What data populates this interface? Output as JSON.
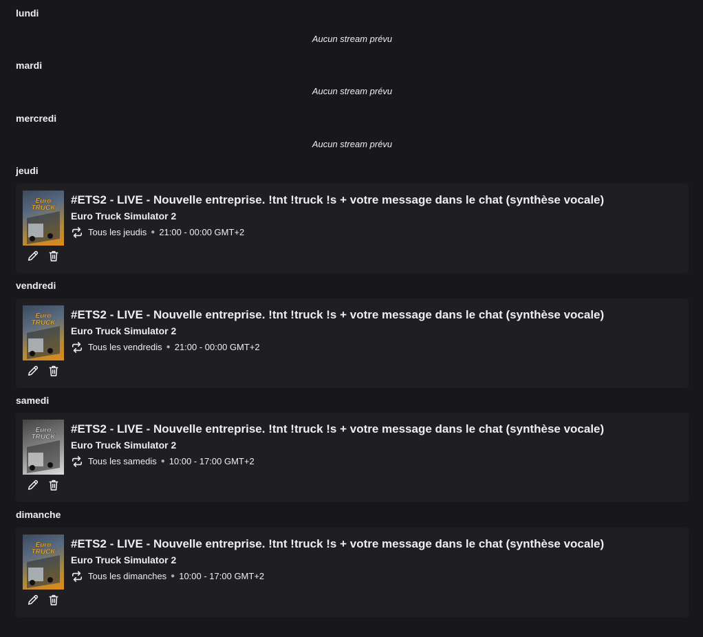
{
  "days": [
    {
      "label": "lundi",
      "empty_text": "Aucun stream prévu"
    },
    {
      "label": "mardi",
      "empty_text": "Aucun stream prévu"
    },
    {
      "label": "mercredi",
      "empty_text": "Aucun stream prévu"
    },
    {
      "label": "jeudi",
      "stream": {
        "title": "#ETS2 - LIVE - Nouvelle entreprise. !tnt !truck !s + votre message dans le chat (synthèse vocale)",
        "game": "Euro Truck Simulator 2",
        "recurrence": "Tous les jeudis",
        "time": "21:00 - 00:00 GMT+2",
        "thumbnail_icon": "euro-truck-simulator-2-cover"
      }
    },
    {
      "label": "vendredi",
      "stream": {
        "title": "#ETS2 - LIVE - Nouvelle entreprise. !tnt !truck !s + votre message dans le chat (synthèse vocale)",
        "game": "Euro Truck Simulator 2",
        "recurrence": "Tous les vendredis",
        "time": "21:00 - 00:00 GMT+2",
        "thumbnail_icon": "euro-truck-simulator-2-cover"
      }
    },
    {
      "label": "samedi",
      "stream": {
        "title": "#ETS2 - LIVE - Nouvelle entreprise. !tnt !truck !s + votre message dans le chat (synthèse vocale)",
        "game": "Euro Truck Simulator 2",
        "recurrence": "Tous les samedis",
        "time": "10:00 - 17:00 GMT+2",
        "thumbnail_icon": "euro-truck-simulator-2-cover-grayscale"
      }
    },
    {
      "label": "dimanche",
      "stream": {
        "title": "#ETS2 - LIVE - Nouvelle entreprise. !tnt !truck !s + votre message dans le chat (synthèse vocale)",
        "game": "Euro Truck Simulator 2",
        "recurrence": "Tous les dimanches",
        "time": "10:00 - 17:00 GMT+2",
        "thumbnail_icon": "euro-truck-simulator-2-cover"
      }
    }
  ],
  "icons": {
    "repeat": "repeat-icon",
    "edit": "pencil-icon",
    "delete": "trash-icon"
  },
  "colors": {
    "background": "#18181b",
    "card": "#1f1f23",
    "text": "#efeff1",
    "muted": "#adadb8"
  }
}
